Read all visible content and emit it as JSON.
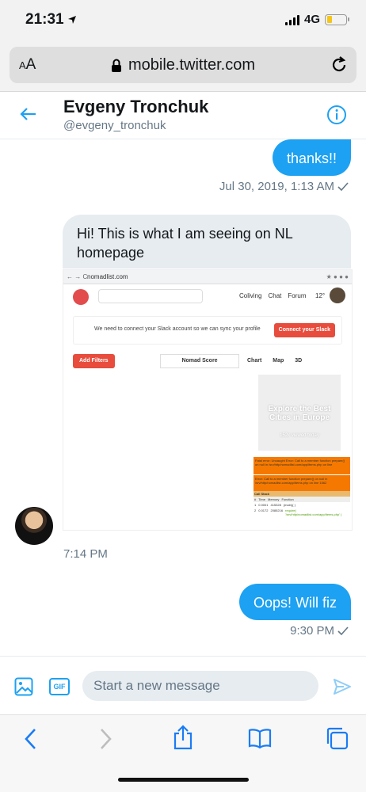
{
  "status": {
    "time": "21:31",
    "network": "4G"
  },
  "browser": {
    "aa_small": "A",
    "aa_large": "A",
    "domain": "mobile.twitter.com"
  },
  "header": {
    "name": "Evgeny Tronchuk",
    "handle": "@evgeny_tronchuk"
  },
  "messages": [
    {
      "text": "thanks!!",
      "meta": "Jul 30, 2019, 1:13 AM"
    },
    {
      "text": "Hi! This is what I am seeing on NL homepage",
      "meta": "7:14 PM"
    },
    {
      "text": "Oops! Will fiz",
      "meta": "9:30 PM"
    }
  ],
  "screenshot": {
    "url": "nomadlist.com",
    "nav_coliving": "Coliving",
    "nav_chat": "Chat",
    "nav_forum": "Forum",
    "weather": "12°",
    "slack_text": "We need to connect your Slack account so we can sync your profile",
    "slack_button": "Connect your Slack",
    "add_filters": "Add Filters",
    "nomad_score": "Nomad Score",
    "chart": "Chart",
    "map": "Map",
    "three_d": "3D",
    "card_title": "Explore the Best Cities in Europe",
    "card_views": "152k viewed today",
    "error1": "Fatal error: Uncaught Error: Call to a member function prepare() on null in /srv/http/nomadlist.com/app/items.php on line",
    "error2": "Error: Call to a member function prepare() on null in /srv/http/nomadlist.com/app/items.php on line 1562",
    "call_stack": "Call Stack",
    "col_num": "#",
    "col_time": "Time",
    "col_memory": "Memory",
    "col_function": "Function",
    "row1": {
      "num": "1",
      "time": "0.0001",
      "memory": "415328",
      "function": "{main}( )"
    },
    "row2": {
      "num": "2",
      "time": "0.0172",
      "memory": "2085216",
      "function": "require( '/srv/http/nomadlist.com/app/items.php' )"
    }
  },
  "composer": {
    "placeholder": "Start a new message",
    "gif": "GIF"
  }
}
